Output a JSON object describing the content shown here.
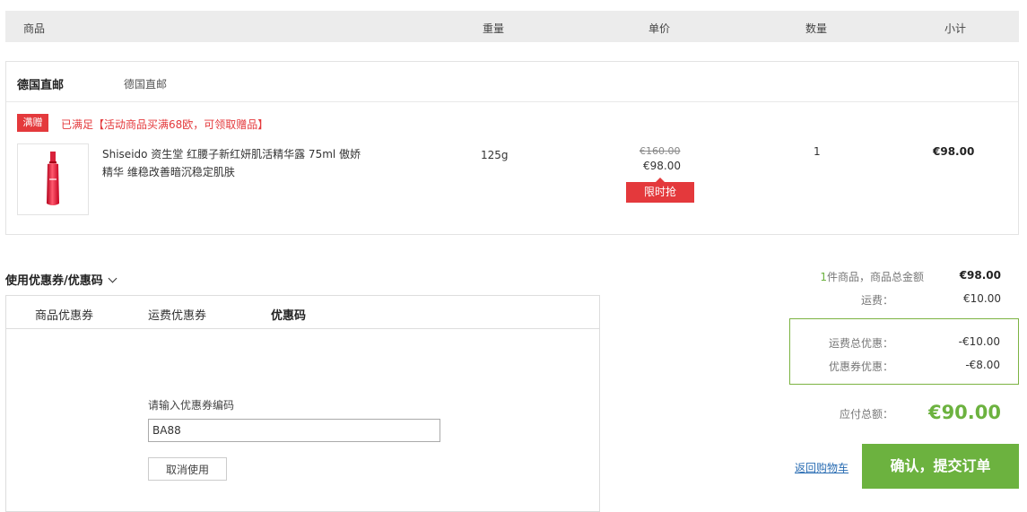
{
  "table_header": {
    "product": "商品",
    "weight": "重量",
    "unit_price": "单价",
    "quantity": "数量",
    "subtotal": "小计"
  },
  "shop": {
    "name": "德国直邮",
    "ship_from": "德国直邮",
    "promo_badge": "满赠",
    "promo_text": "已满足【活动商品买满68欧，可领取赠品】"
  },
  "item": {
    "image_icon": "red-serum-bottle",
    "name": "Shiseido 资生堂 红腰子新红妍肌活精华露 75ml 傲娇精华 维稳改善暗沉稳定肌肤",
    "weight": "125g",
    "original_price": "€160.00",
    "price": "€98.00",
    "flash_sale_label": "限时抢",
    "quantity": "1",
    "subtotal": "€98.00"
  },
  "coupons": {
    "title": "使用优惠券/优惠码",
    "tabs": [
      "商品优惠券",
      "运费优惠券",
      "优惠码"
    ],
    "active_tab": 2,
    "input_label": "请输入优惠券编码",
    "input_value": "BA88",
    "cancel_label": "取消使用"
  },
  "summary": {
    "items_count": "1",
    "items_label": "件商品，商品总金额",
    "items_total": "€98.00",
    "shipping_label": "运费：",
    "shipping_value": "€10.00",
    "shipping_discount_label": "运费总优惠：",
    "shipping_discount_value": "-€10.00",
    "coupon_discount_label": "优惠券优惠：",
    "coupon_discount_value": "-€8.00",
    "total_label": "应付总额：",
    "total_value": "€90.00",
    "back_link": "返回购物车",
    "submit_label": "确认，提交订单"
  },
  "colors": {
    "accent_red": "#e4393c",
    "accent_green": "#6cb23f",
    "link_blue": "#2a6db3"
  }
}
